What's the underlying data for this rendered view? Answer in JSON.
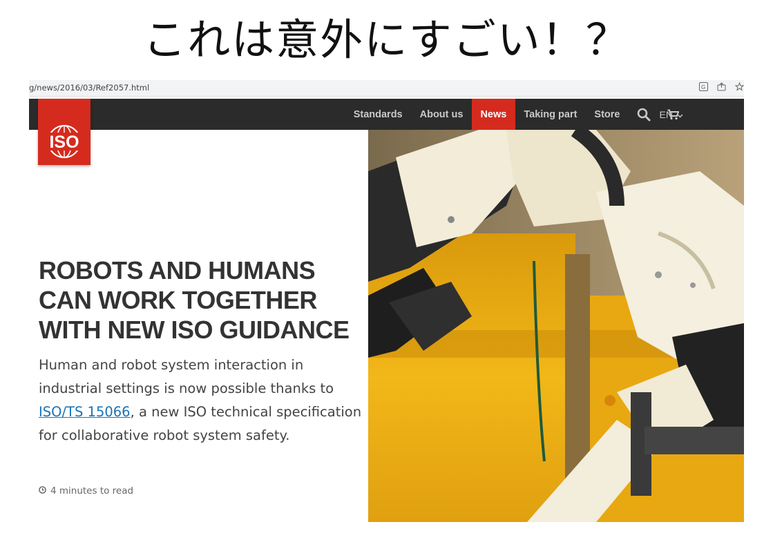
{
  "caption": "これは意外にすごい！？",
  "browser": {
    "url": "g/news/2016/03/Ref2057.html",
    "icons": [
      "translate-icon",
      "share-icon",
      "star-icon"
    ]
  },
  "nav": {
    "items": [
      "Standards",
      "About us",
      "News",
      "Taking part",
      "Store"
    ],
    "active": "News",
    "language": "EN",
    "icons": [
      "search-icon",
      "cart-icon",
      "chevron-down-icon"
    ]
  },
  "logo": {
    "text": "ISO",
    "color": "#d52b1e"
  },
  "article": {
    "headline": "ROBOTS AND HUMANS CAN WORK TOGETHER WITH NEW ISO GUIDANCE",
    "summary_before": "Human and robot system interaction in industrial settings is now possible thanks to ",
    "summary_link": "ISO/TS 15066",
    "summary_after": ", a new ISO technical specification for collaborative robot system safety.",
    "read_time": "4 minutes to read"
  },
  "colors": {
    "accent": "#d52b1e",
    "navbar": "#2b2b2b",
    "link": "#1a73b8"
  }
}
